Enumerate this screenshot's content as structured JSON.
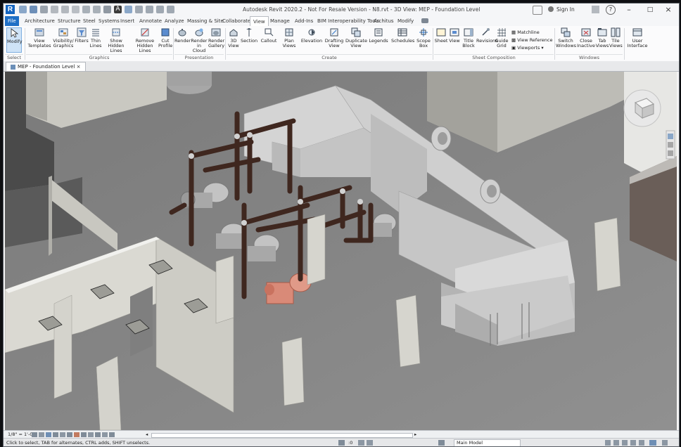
{
  "titlebar": {
    "app_logo": "R",
    "title": "Autodesk Revit 2020.2 - Not For Resale Version - N8.rvt - 3D View: MEP - Foundation Level",
    "sign_in": "Sign In",
    "help_label": "?"
  },
  "ribbon_tabs": [
    "File",
    "Architecture",
    "Structure",
    "Steel",
    "Systems",
    "Insert",
    "Annotate",
    "Analyze",
    "Massing & Site",
    "Collaborate",
    "View",
    "Manage",
    "Add-Ins",
    "BIM Interoperability Tools",
    "Architus",
    "Modify"
  ],
  "active_tab": "View",
  "ribbon": {
    "modify": "Modify",
    "select": "Select",
    "graphics_buttons": [
      "View Templates",
      "Visibility/ Graphics",
      "Filters",
      "Thin Lines",
      "Show Hidden Lines",
      "Remove Hidden Lines",
      "Cut Profile"
    ],
    "presentation_buttons": [
      "Render",
      "Render in Cloud",
      "Render Gallery"
    ],
    "create_buttons": [
      "3D View",
      "Section",
      "Callout",
      "Plan Views",
      "Elevation",
      "Drafting View",
      "Duplicate View",
      "Legends",
      "Schedules",
      "Scope Box"
    ],
    "sheet_buttons": [
      "Sheet",
      "View",
      "Title Block",
      "Revisions",
      "Guide Grid"
    ],
    "sheet_small": [
      "Matchline",
      "View Reference",
      "Viewports"
    ],
    "windows_buttons": [
      "Switch Windows",
      "Close Inactive",
      "Tab Views",
      "Tile Views"
    ],
    "ui_button": "User Interface",
    "groups": {
      "select": "Select",
      "graphics": "Graphics",
      "presentation": "Presentation",
      "create": "Create",
      "sheet_composition": "Sheet Composition",
      "windows": "Windows"
    }
  },
  "view_tab": {
    "label": "MEP - Foundation Level"
  },
  "viewbar": {
    "scale": "1/8\" = 1'-0\""
  },
  "statusbar": {
    "hint": "Click to select, TAB for alternates, CTRL adds, SHIFT unselects.",
    "zero": ":0",
    "model": "Main Model"
  },
  "colors": {
    "file_tab": "#1f6fc5",
    "pipe": "#4a2e24",
    "pump_selected": "#d98a78",
    "duct": "#c7c7c7",
    "floor": "#8a8a8a",
    "wall": "#d9d8d2"
  }
}
